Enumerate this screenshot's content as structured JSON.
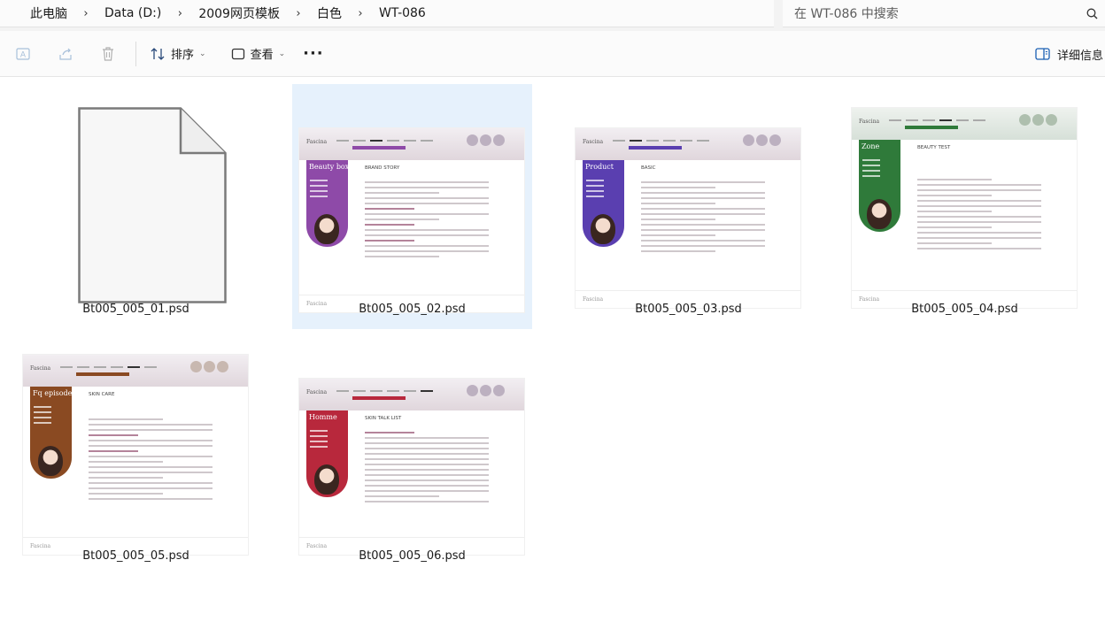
{
  "breadcrumb": {
    "items": [
      "此电脑",
      "Data (D:)",
      "2009网页模板",
      "白色",
      "WT-086"
    ],
    "separator": "›"
  },
  "search": {
    "placeholder": "在 WT-086 中搜索"
  },
  "toolbar": {
    "sort_label": "排序",
    "view_label": "查看",
    "more_label": "···",
    "details_label": "详细信息"
  },
  "files": [
    {
      "name": "Bt005_005_01.psd",
      "selected": false,
      "preview": "blank"
    },
    {
      "name": "Bt005_005_02.psd",
      "selected": true,
      "preview": "Beauty box",
      "page_heading": "BRAND STORY",
      "accent": "#8e4aa8"
    },
    {
      "name": "Bt005_005_03.psd",
      "selected": false,
      "preview": "Product",
      "page_heading": "BASIC",
      "accent": "#5a3fb0"
    },
    {
      "name": "Bt005_005_04.psd",
      "selected": false,
      "preview": "Zone",
      "page_heading": "BEAUTY TEST",
      "accent": "#2f7a3a"
    },
    {
      "name": "Bt005_005_05.psd",
      "selected": false,
      "preview": "Fq episode",
      "page_heading": "SKIN CARE",
      "accent": "#8a4a22"
    },
    {
      "name": "Bt005_005_06.psd",
      "selected": false,
      "preview": "Homme",
      "page_heading": "SKIN TALK LIST",
      "accent": "#b8283c"
    }
  ],
  "colors": {
    "selection": "#e6f1fc",
    "chrome_bg": "#fbfbfb",
    "accent_blue": "#1a73c8"
  }
}
